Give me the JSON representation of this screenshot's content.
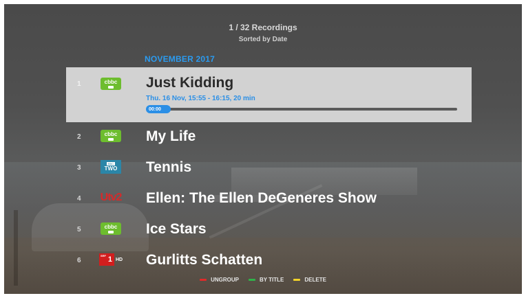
{
  "header": {
    "count_title": "1 / 32 Recordings",
    "sort_label": "Sorted by Date"
  },
  "month_header": "NOVEMBER 2017",
  "recordings": [
    {
      "number": "1",
      "channel": "CBBC",
      "channel_logo_text": "cbbc",
      "title": "Just Kidding",
      "meta": "Thu. 16 Nov, 15:55 - 16:15, 20 min",
      "progress_label": "00:00",
      "progress": 0,
      "selected": true
    },
    {
      "number": "2",
      "channel": "CBBC",
      "channel_logo_text": "cbbc",
      "title": "My Life"
    },
    {
      "number": "3",
      "channel": "BBC TWO",
      "channel_logo_text": "TWO",
      "title": "Tennis"
    },
    {
      "number": "4",
      "channel": "UTV2",
      "channel_logo_text": "Utv2",
      "title": "Ellen: The Ellen DeGeneres Show"
    },
    {
      "number": "5",
      "channel": "CBBC",
      "channel_logo_text": "cbbc",
      "title": "Ice Stars"
    },
    {
      "number": "6",
      "channel": "SRF 1 HD",
      "channel_logo_text": "1",
      "title": "Gurlitts Schatten"
    }
  ],
  "footer": [
    {
      "label": "UNGROUP",
      "color": "#e02a2a"
    },
    {
      "label": "BY TITLE",
      "color": "#2fb34a"
    },
    {
      "label": "DELETE",
      "color": "#f2d22a"
    }
  ],
  "colors": {
    "accent": "#2b9bf0",
    "selected_row": "#d2d2d2"
  }
}
